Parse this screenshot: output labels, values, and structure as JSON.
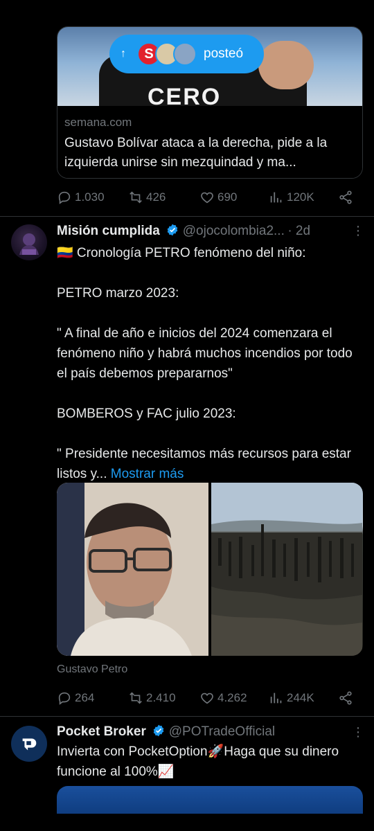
{
  "tweet1": {
    "posted_label": "posteó",
    "posted_avatar_letter": "S",
    "card_domain": "semana.com",
    "card_title": "Gustavo Bolívar ataca a la derecha, pide a la izquierda unirse sin mezquindad y ma...",
    "card_image_text": "CERO",
    "actions": {
      "replies": "1.030",
      "reposts": "426",
      "likes": "690",
      "views": "120K"
    }
  },
  "tweet2": {
    "name": "Misión cumplida",
    "handle": "@ojocolombia2...",
    "dot_time": "· 2d",
    "text": "🇨🇴 Cronología PETRO fenómeno del niño:\n\nPETRO marzo 2023:\n\n\" A final de año e inicios del 2024 comenzara el fenómeno niño y habrá muchos incendios por todo el país debemos prepararnos\"\n\nBOMBEROS y FAC julio 2023:\n\n\" Presidente necesitamos más recursos para estar listos y...",
    "show_more": " Mostrar más",
    "media_caption": "Gustavo Petro",
    "actions": {
      "replies": "264",
      "reposts": "2.410",
      "likes": "4.262",
      "views": "244K"
    }
  },
  "tweet3": {
    "name": "Pocket Broker",
    "handle": "@POTradeOfficial",
    "text": "Invierta con PocketOption🚀Haga que su dinero funcione al 100%📈"
  },
  "colors": {
    "accent": "#1d9bf0",
    "muted": "#71767b",
    "background": "#000000",
    "divider": "#2f3336"
  },
  "icons": [
    "arrow-up-icon",
    "reply-icon",
    "repost-icon",
    "like-icon",
    "views-icon",
    "share-icon",
    "verified-icon",
    "more-icon"
  ]
}
